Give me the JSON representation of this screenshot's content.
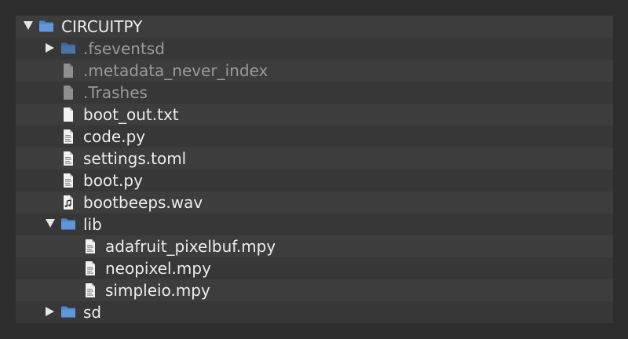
{
  "tree": {
    "items": [
      {
        "label": "CIRCUITPY",
        "kind": "folder",
        "expanded": true
      },
      {
        "label": ".fseventsd",
        "kind": "folder",
        "expanded": false,
        "hidden": true
      },
      {
        "label": ".metadata_never_index",
        "kind": "file",
        "hidden": true
      },
      {
        "label": ".Trashes",
        "kind": "file",
        "hidden": true
      },
      {
        "label": "boot_out.txt",
        "kind": "file"
      },
      {
        "label": "code.py",
        "kind": "code-file"
      },
      {
        "label": "settings.toml",
        "kind": "code-file"
      },
      {
        "label": "boot.py",
        "kind": "code-file"
      },
      {
        "label": "bootbeeps.wav",
        "kind": "audio-file"
      },
      {
        "label": "lib",
        "kind": "folder",
        "expanded": true
      },
      {
        "label": "adafruit_pixelbuf.mpy",
        "kind": "code-file"
      },
      {
        "label": "neopixel.mpy",
        "kind": "code-file"
      },
      {
        "label": "simpleio.mpy",
        "kind": "code-file"
      },
      {
        "label": "sd",
        "kind": "folder",
        "expanded": false
      }
    ]
  },
  "colors": {
    "background": "#2d2d2d",
    "panel": "#373737",
    "panel_alt_row": "#3d3d3d",
    "text": "#ececec",
    "hidden_text": "#9a9a9a",
    "folder": "#4f86cf"
  }
}
